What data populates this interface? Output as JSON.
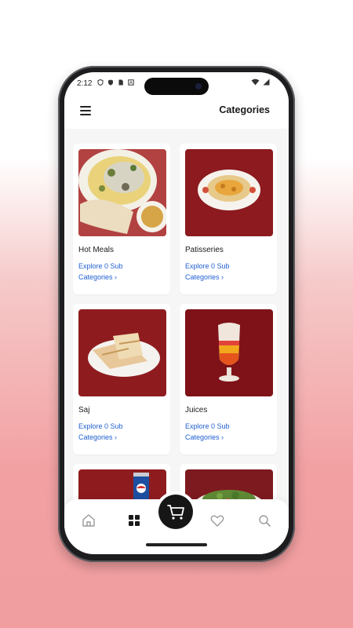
{
  "status_bar": {
    "time": "2:12"
  },
  "app_bar": {
    "title": "Categories"
  },
  "categories": [
    {
      "name": "Hot Meals",
      "link_line1": "Explore 0 Sub",
      "link_line2": "Categories ›",
      "image": "plate-with-bread-and-soup"
    },
    {
      "name": "Patisseries",
      "link_line1": "Explore 0 Sub",
      "link_line2": "Categories ›",
      "image": "hummus-plate"
    },
    {
      "name": "Saj",
      "link_line1": "Explore 0 Sub",
      "link_line2": "Categories ›",
      "image": "saj-wrap-plate"
    },
    {
      "name": "Juices",
      "link_line1": "Explore 0 Sub",
      "link_line2": "Categories ›",
      "image": "layered-juice-glass"
    },
    {
      "name": "",
      "link_line1": "",
      "link_line2": "",
      "image": "soda-can"
    },
    {
      "name": "",
      "link_line1": "",
      "link_line2": "",
      "image": "salad-bowl"
    }
  ],
  "bottom_nav": {
    "items": [
      "home-icon",
      "grid-icon",
      "cart-icon",
      "heart-icon",
      "search-icon"
    ],
    "active": "grid-icon"
  },
  "colors": {
    "link": "#1f5fd1",
    "image_bg": "#8b1e22",
    "fab": "#161616"
  }
}
